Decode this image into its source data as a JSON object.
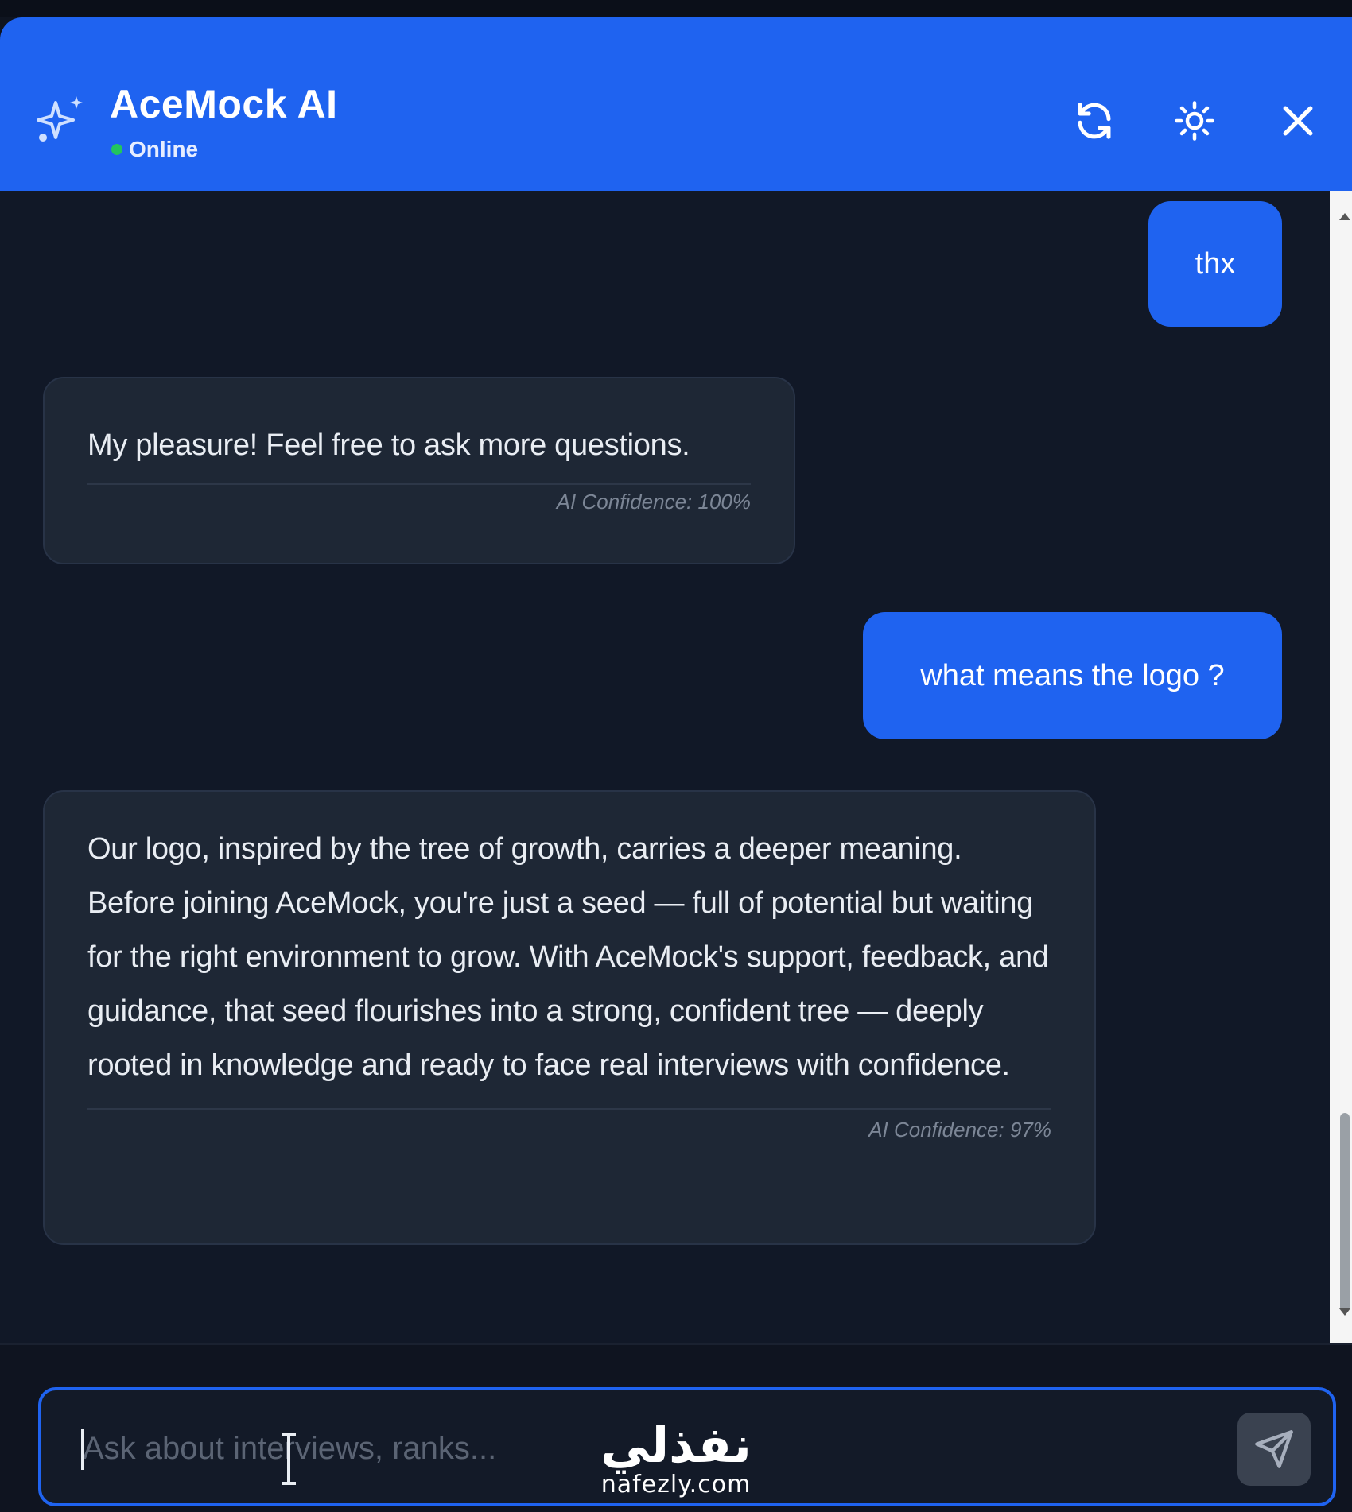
{
  "header": {
    "title": "AceMock AI",
    "status": "Online",
    "accent_color": "#1f63f0",
    "status_color": "#22c55e",
    "icons": {
      "logo": "sparkles-icon",
      "refresh": "refresh-icon",
      "theme": "sun-icon",
      "close": "close-icon"
    }
  },
  "messages": [
    {
      "role": "user",
      "text": "thx"
    },
    {
      "role": "ai",
      "text": "My pleasure! Feel free to ask more questions.",
      "confidence": "AI Confidence: 100%"
    },
    {
      "role": "user",
      "text": "what means the logo ?"
    },
    {
      "role": "ai",
      "text": "Our logo, inspired by the tree of growth, carries a deeper meaning. Before joining AceMock, you're just a seed — full of potential but waiting for the right environment to grow. With AceMock's support, feedback, and guidance, that seed flourishes into a strong, confident tree — deeply rooted in knowledge and ready to face real interviews with confidence.",
      "confidence": "AI Confidence: 97%"
    }
  ],
  "composer": {
    "placeholder": "Ask about interviews, ranks...",
    "value": "",
    "send_icon": "send-icon"
  },
  "watermark": {
    "arabic": "نفذلي",
    "latin": "nafezly.com"
  }
}
